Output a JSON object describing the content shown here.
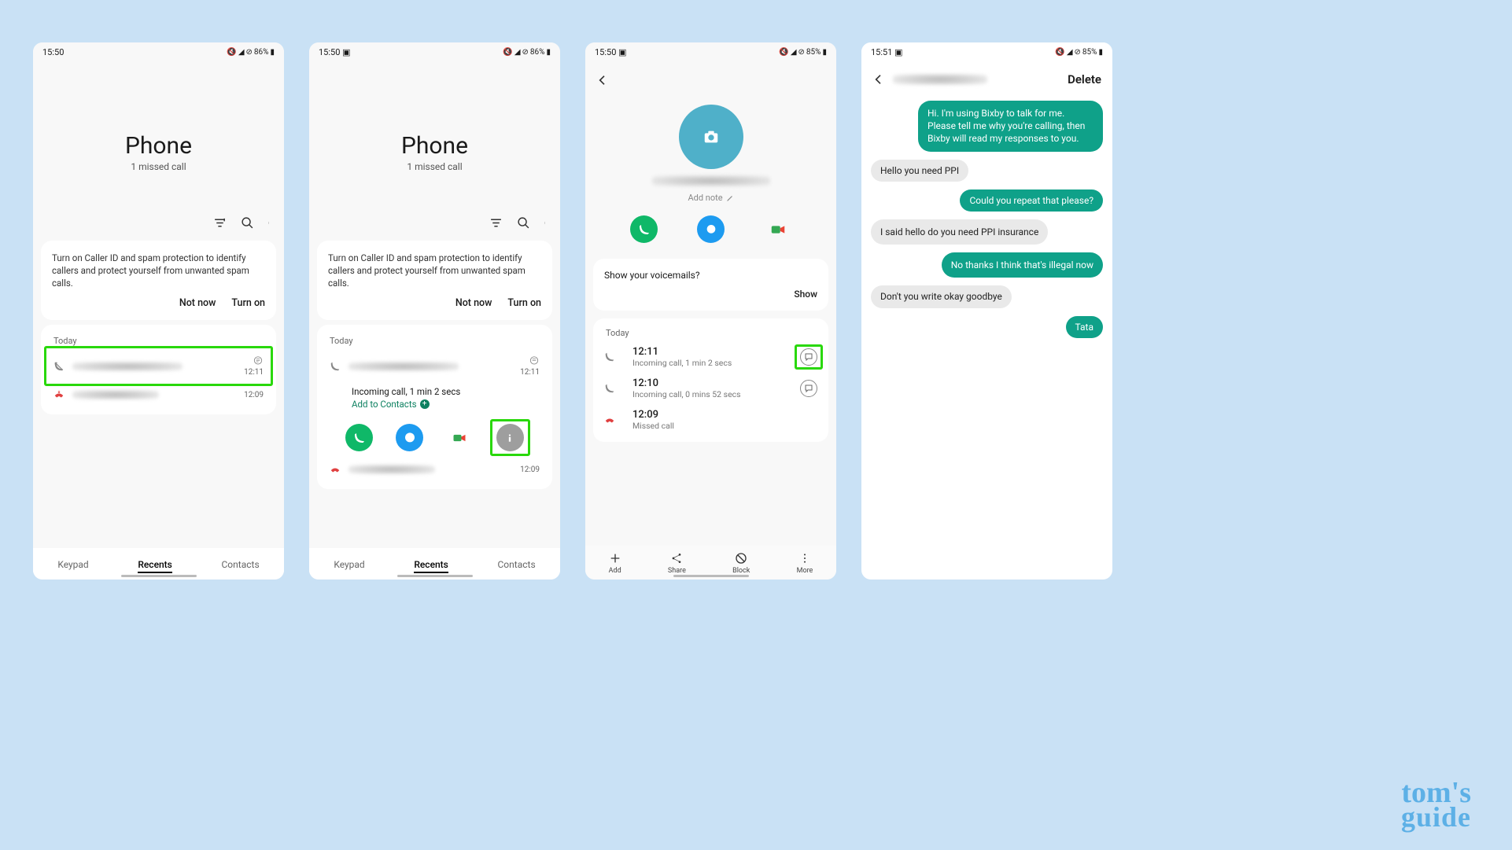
{
  "logo": {
    "line1": "tom's",
    "line2": "guide"
  },
  "status_icons": "◢ ⊘",
  "screen1": {
    "time": "15:50",
    "battery": "86%",
    "title": "Phone",
    "subtitle": "1 missed call",
    "spam_msg": "Turn on Caller ID and spam protection to identify callers and protect yourself from unwanted spam calls.",
    "not_now": "Not now",
    "turn_on": "Turn on",
    "today": "Today",
    "call_time_1": "12:11",
    "call_time_2": "12:09",
    "tabs": {
      "keypad": "Keypad",
      "recents": "Recents",
      "contacts": "Contacts"
    }
  },
  "screen2": {
    "time": "15:50",
    "battery": "86%",
    "title": "Phone",
    "subtitle": "1 missed call",
    "spam_msg": "Turn on Caller ID and spam protection to identify callers and protect yourself from unwanted spam calls.",
    "not_now": "Not now",
    "turn_on": "Turn on",
    "today": "Today",
    "call_time_1": "12:11",
    "call_detail": "Incoming call, 1 min 2 secs",
    "add_contacts": "Add to Contacts",
    "call_time_2": "12:09",
    "tabs": {
      "keypad": "Keypad",
      "recents": "Recents",
      "contacts": "Contacts"
    }
  },
  "screen3": {
    "time": "15:50",
    "battery": "85%",
    "add_note": "Add note",
    "vm_prompt": "Show your voicemails?",
    "vm_show": "Show",
    "today": "Today",
    "log": [
      {
        "time": "12:11",
        "desc": "Incoming call, 1 min 2 secs"
      },
      {
        "time": "12:10",
        "desc": "Incoming call, 0 mins 52 secs"
      },
      {
        "time": "12:09",
        "desc": "Missed call"
      }
    ],
    "actions": {
      "add": "Add",
      "share": "Share",
      "block": "Block",
      "more": "More"
    }
  },
  "screen4": {
    "time": "15:51",
    "battery": "85%",
    "delete": "Delete",
    "messages": [
      {
        "side": "out",
        "text": "Hi. I'm using Bixby to talk for me. Please tell me why you're calling, then Bixby will read my responses to you."
      },
      {
        "side": "in",
        "text": "Hello you need PPI"
      },
      {
        "side": "out",
        "text": "Could you repeat that please?"
      },
      {
        "side": "in",
        "text": "I said hello do you need PPI insurance"
      },
      {
        "side": "out",
        "text": "No thanks I think that's illegal now"
      },
      {
        "side": "in",
        "text": "Don't you write okay goodbye"
      },
      {
        "side": "out",
        "text": "Tata"
      }
    ]
  }
}
